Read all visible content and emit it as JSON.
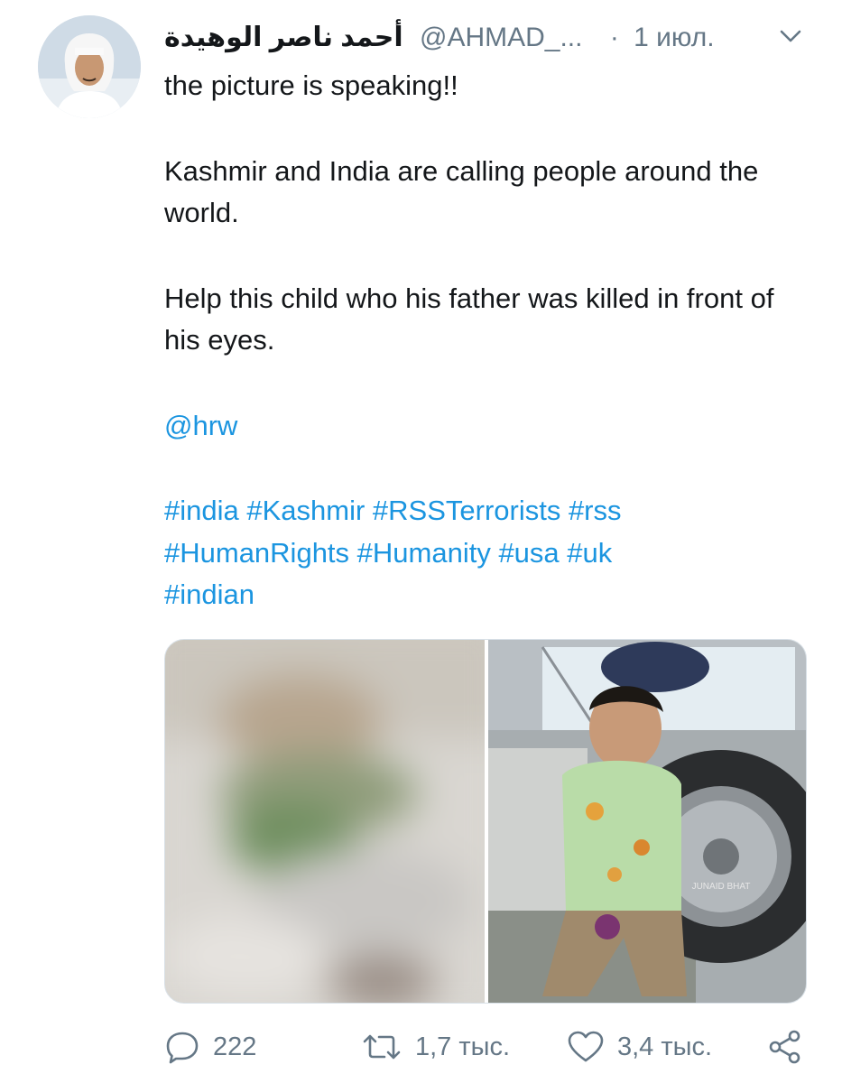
{
  "tweet": {
    "author_name": "أحمد ناصر الوهيدة",
    "handle": "@AHMAD_...",
    "separator": "·",
    "date": "1 июл.",
    "paragraphs": [
      "the picture is speaking!!",
      "Kashmir and India are calling people around the world.",
      "Help this child who his father was killed in front of his eyes."
    ],
    "mention": "@hrw",
    "hashtags_lines": [
      "#india #Kashmir #RSSTerrorists #rss",
      "#HumanRights #Humanity #usa #uk",
      "#indian"
    ],
    "photo_watermark": "JUNAID BHAT"
  },
  "actions": {
    "replies": "222",
    "retweets": "1,7 тыс.",
    "likes": "3,4 тыс."
  },
  "icons": {
    "more": "chevron-down-icon",
    "reply": "speech-bubble-icon",
    "retweet": "retweet-arrows-icon",
    "like": "heart-outline-icon",
    "share": "share-nodes-icon"
  },
  "colors": {
    "text": "#14171a",
    "muted": "#657786",
    "link": "#1b95e0",
    "background": "#ffffff"
  }
}
